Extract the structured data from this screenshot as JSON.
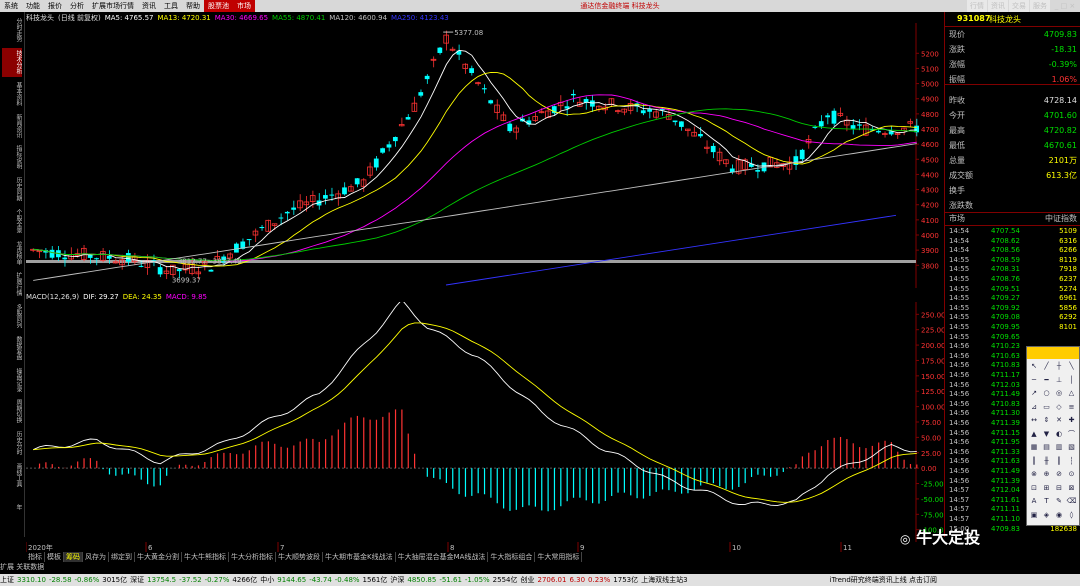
{
  "menubar": {
    "items": [
      "系统",
      "功能",
      "报价",
      "分析",
      "扩展市场行情",
      "资讯",
      "工具",
      "帮助"
    ],
    "hot_item": "股票池",
    "extra_item": "市场",
    "center_title": "通达信金融终端 科技龙头",
    "right_items": [
      "行情",
      "资讯",
      "交易",
      "服务"
    ]
  },
  "left_toolbar": {
    "items": [
      "分时走势",
      "技术分析",
      "基本资料",
      "新闻资讯",
      "指标说明",
      "历史同期",
      "个股全景",
      "龙虎榜单",
      "扩展行情",
      "多股同列",
      "数据复盘",
      "操盘记录",
      "周期切换",
      "历史分时",
      "画线工具",
      "年"
    ],
    "active_index": 1
  },
  "main_chart": {
    "name": "科技龙头",
    "period": "(日线 前复权)",
    "ma": [
      {
        "label": "MA5: 4765.57",
        "color": "#ffffff"
      },
      {
        "label": "MA13: 4720.31",
        "color": "#ffff00"
      },
      {
        "label": "MA30: 4669.65",
        "color": "#ff00ff"
      },
      {
        "label": "MA55: 4870.41",
        "color": "#00cc00"
      },
      {
        "label": "MA120: 4600.94",
        "color": "#c0c0c0"
      },
      {
        "label": "MA250: 4123.43",
        "color": "#3333ff"
      }
    ],
    "price_axis": [
      "5200",
      "5100",
      "5000",
      "4900",
      "4800",
      "4700",
      "4600",
      "4500",
      "4400",
      "4300",
      "4200",
      "4100",
      "4000",
      "3900",
      "3800"
    ],
    "high_annotation": "5377.08",
    "low_annotation": "3699.37",
    "range_annotation": "3812.77~3837.49"
  },
  "macd": {
    "title": "MACD(12,26,9)",
    "dif": "DIF: 29.27",
    "dea": "DEA: 24.35",
    "macd": "MACD: 9.85",
    "axis": [
      "250.00",
      "225.00",
      "200.00",
      "175.00",
      "150.00",
      "125.00",
      "100.00",
      "75.00",
      "50.00",
      "25.00",
      "0.00",
      "-25.00",
      "-50.00",
      "-75.00",
      "-100.00"
    ]
  },
  "date_axis": [
    "2020年",
    "6",
    "7",
    "8",
    "9",
    "10",
    "11"
  ],
  "quote": {
    "code": "931087",
    "name": "科技龙头",
    "rows": [
      {
        "k": "现价",
        "v": "4709.83",
        "c": "g"
      },
      {
        "k": "涨跌",
        "v": "-18.31",
        "c": "g"
      },
      {
        "k": "涨幅",
        "v": "-0.39%",
        "c": "g"
      },
      {
        "k": "振幅",
        "v": "1.06%",
        "c": "r"
      },
      {
        "k": "昨收",
        "v": "4728.14",
        "c": "w"
      },
      {
        "k": "今开",
        "v": "4701.60",
        "c": "g"
      },
      {
        "k": "最高",
        "v": "4720.82",
        "c": "g"
      },
      {
        "k": "最低",
        "v": "4670.61",
        "c": "g"
      },
      {
        "k": "总量",
        "v": "2101万",
        "c": "y"
      },
      {
        "k": "成交额",
        "v": "613.3亿",
        "c": "y"
      },
      {
        "k": "换手",
        "v": "",
        "c": "w"
      },
      {
        "k": "涨跌数",
        "v": "",
        "c": "w"
      }
    ],
    "market_label": "市场",
    "market_value": "中证指数"
  },
  "ticks": [
    {
      "t": "14:54",
      "p": "4707.54",
      "v": "5109"
    },
    {
      "t": "14:54",
      "p": "4708.62",
      "v": "6316"
    },
    {
      "t": "14:54",
      "p": "4708.56",
      "v": "6266"
    },
    {
      "t": "14:55",
      "p": "4708.59",
      "v": "8119"
    },
    {
      "t": "14:55",
      "p": "4708.31",
      "v": "7918"
    },
    {
      "t": "14:55",
      "p": "4708.76",
      "v": "6237"
    },
    {
      "t": "14:55",
      "p": "4709.51",
      "v": "5274"
    },
    {
      "t": "14:55",
      "p": "4709.27",
      "v": "6961"
    },
    {
      "t": "14:55",
      "p": "4709.92",
      "v": "5856"
    },
    {
      "t": "14:55",
      "p": "4709.08",
      "v": "6292"
    },
    {
      "t": "14:55",
      "p": "4709.95",
      "v": "8101"
    },
    {
      "t": "14:55",
      "p": "4709.65",
      "v": ""
    },
    {
      "t": "14:56",
      "p": "4710.23",
      "v": ""
    },
    {
      "t": "14:56",
      "p": "4710.63",
      "v": ""
    },
    {
      "t": "14:56",
      "p": "4710.83",
      "v": ""
    },
    {
      "t": "14:56",
      "p": "4711.17",
      "v": ""
    },
    {
      "t": "14:56",
      "p": "4712.03",
      "v": ""
    },
    {
      "t": "14:56",
      "p": "4711.49",
      "v": ""
    },
    {
      "t": "14:56",
      "p": "4710.83",
      "v": ""
    },
    {
      "t": "14:56",
      "p": "4711.30",
      "v": ""
    },
    {
      "t": "14:56",
      "p": "4711.39",
      "v": ""
    },
    {
      "t": "14:56",
      "p": "4711.15",
      "v": ""
    },
    {
      "t": "14:56",
      "p": "4711.95",
      "v": ""
    },
    {
      "t": "14:56",
      "p": "4711.33",
      "v": ""
    },
    {
      "t": "14:56",
      "p": "4711.63",
      "v": ""
    },
    {
      "t": "14:56",
      "p": "4711.49",
      "v": ""
    },
    {
      "t": "14:56",
      "p": "4711.39",
      "v": ""
    },
    {
      "t": "14:57",
      "p": "4712.04",
      "v": ""
    },
    {
      "t": "14:57",
      "p": "4711.61",
      "v": ""
    },
    {
      "t": "14:57",
      "p": "4711.11",
      "v": ""
    },
    {
      "t": "14:57",
      "p": "4711.10",
      "v": ""
    },
    {
      "t": "15:00",
      "p": "4709.83",
      "v": "182638"
    }
  ],
  "tabs": [
    "指标",
    "模板",
    "筹码",
    "风存为",
    "绑定到",
    "牛大黄金分割",
    "牛大牛熊指标",
    "牛大分析指标",
    "牛大顺势波段",
    "牛大期市基金K线战法",
    "牛大抽屉混合基金MA线战法",
    "牛大指标组合",
    "牛大常用指标"
  ],
  "tabs_active_index": 2,
  "bottom_left": {
    "expand": "扩展",
    "associated": "关联数据"
  },
  "status": [
    {
      "text": "上证",
      "c": ""
    },
    {
      "text": "3310.10",
      "c": "g"
    },
    {
      "text": "-28.58",
      "c": "g"
    },
    {
      "text": "-0.86%",
      "c": "g"
    },
    {
      "text": "3015亿",
      "c": ""
    },
    {
      "text": "深证",
      "c": ""
    },
    {
      "text": "13754.5",
      "c": "g"
    },
    {
      "text": "-37.52",
      "c": "g"
    },
    {
      "text": "-0.27%",
      "c": "g"
    },
    {
      "text": "4266亿",
      "c": ""
    },
    {
      "text": "中小",
      "c": ""
    },
    {
      "text": "9144.65",
      "c": "g"
    },
    {
      "text": "-43.74",
      "c": "g"
    },
    {
      "text": "-0.48%",
      "c": "g"
    },
    {
      "text": "1561亿",
      "c": ""
    },
    {
      "text": "沪深",
      "c": ""
    },
    {
      "text": "4850.85",
      "c": "g"
    },
    {
      "text": "-51.61",
      "c": "g"
    },
    {
      "text": "-1.05%",
      "c": "g"
    },
    {
      "text": "2554亿",
      "c": ""
    },
    {
      "text": "创业",
      "c": ""
    },
    {
      "text": "2706.01",
      "c": "r"
    },
    {
      "text": "6.30",
      "c": "r"
    },
    {
      "text": "0.23%",
      "c": "r"
    },
    {
      "text": "1753亿",
      "c": ""
    },
    {
      "text": "上海双线主站3",
      "c": ""
    }
  ],
  "status_right": "iTrend研究终端资讯上线 点击订阅",
  "watermark": "牛大定投",
  "colors": {
    "up": "#ff3333",
    "down": "#00ffff",
    "accent": "#c00000"
  }
}
